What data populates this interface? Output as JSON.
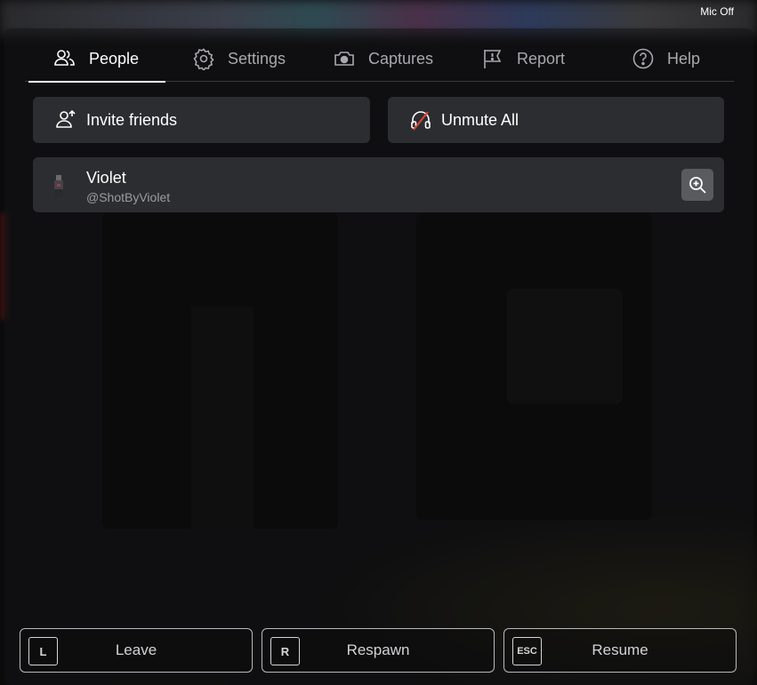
{
  "status": {
    "mic": "Mic Off"
  },
  "tabs": [
    {
      "label": "People",
      "icon": "people-icon",
      "active": true
    },
    {
      "label": "Settings",
      "icon": "gear-icon",
      "active": false
    },
    {
      "label": "Captures",
      "icon": "camera-icon",
      "active": false
    },
    {
      "label": "Report",
      "icon": "flag-icon",
      "active": false
    },
    {
      "label": "Help",
      "icon": "help-icon",
      "active": false
    }
  ],
  "actions": {
    "invite": {
      "label": "Invite friends",
      "icon": "add-friend-icon"
    },
    "unmute": {
      "label": "Unmute All",
      "icon": "headphones-muted-icon"
    }
  },
  "players": [
    {
      "name": "Violet",
      "handle": "@ShotByViolet",
      "action_icon": "zoom-in-icon"
    }
  ],
  "footer": [
    {
      "key": "L",
      "label": "Leave"
    },
    {
      "key": "R",
      "label": "Respawn"
    },
    {
      "key": "ESC",
      "label": "Resume"
    }
  ],
  "colors": {
    "panel": "#2c2d30",
    "text": "#ffffff",
    "muted_text": "#a8a9ad",
    "mute_slash": "#e0423a"
  }
}
